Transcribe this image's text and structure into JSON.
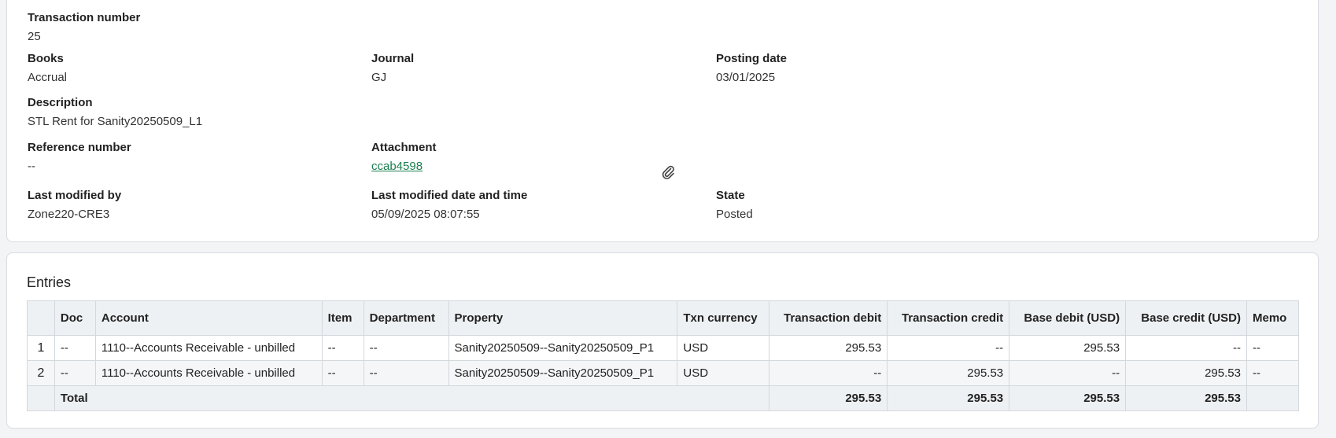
{
  "details": {
    "transaction_number": {
      "label": "Transaction number",
      "value": "25"
    },
    "books": {
      "label": "Books",
      "value": "Accrual"
    },
    "journal": {
      "label": "Journal",
      "value": "GJ"
    },
    "posting_date": {
      "label": "Posting date",
      "value": "03/01/2025"
    },
    "description": {
      "label": "Description",
      "value": "STL Rent for Sanity20250509_L1"
    },
    "reference_number": {
      "label": "Reference number",
      "value": "--"
    },
    "attachment": {
      "label": "Attachment",
      "value": "ccab4598",
      "icon": "paperclip-icon"
    },
    "last_modified_by": {
      "label": "Last modified by",
      "value": "Zone220-CRE3"
    },
    "last_modified_datetime": {
      "label": "Last modified date and time",
      "value": "05/09/2025 08:07:55"
    },
    "state": {
      "label": "State",
      "value": "Posted"
    }
  },
  "entries": {
    "title": "Entries",
    "columns": [
      "",
      "Doc",
      "Account",
      "Item",
      "Department",
      "Property",
      "Txn currency",
      "Transaction debit",
      "Transaction credit",
      "Base debit (USD)",
      "Base credit (USD)",
      "Memo"
    ],
    "rows": [
      [
        "1",
        "--",
        "1110--Accounts Receivable - unbilled",
        "--",
        "--",
        "Sanity20250509--Sanity20250509_P1",
        "USD",
        "295.53",
        "--",
        "295.53",
        "--",
        "--"
      ],
      [
        "2",
        "--",
        "1110--Accounts Receivable - unbilled",
        "--",
        "--",
        "Sanity20250509--Sanity20250509_P1",
        "USD",
        "--",
        "295.53",
        "--",
        "295.53",
        "--"
      ]
    ],
    "total": {
      "label": "Total",
      "transaction_debit": "295.53",
      "transaction_credit": "295.53",
      "base_debit": "295.53",
      "base_credit": "295.53"
    }
  },
  "colors": {
    "link": "#1a7f4f",
    "header_bg": "#eef1f3",
    "border": "#d3d8dd"
  }
}
